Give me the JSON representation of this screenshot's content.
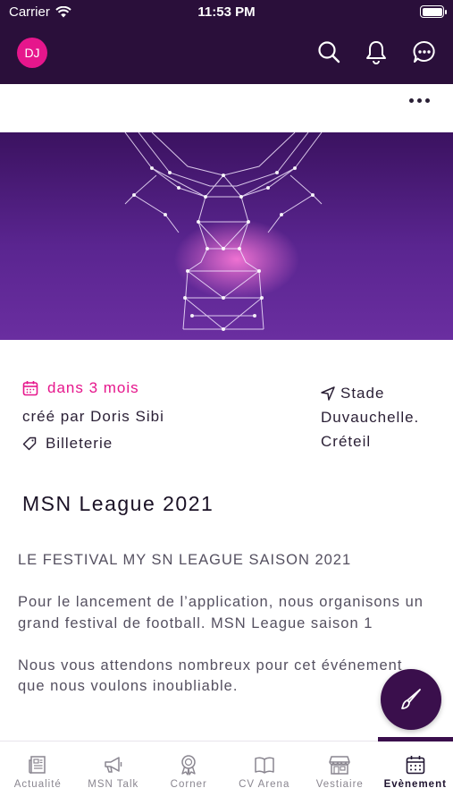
{
  "status_bar": {
    "carrier": "Carrier",
    "time": "11:53 PM"
  },
  "header": {
    "avatar_initials": "DJ"
  },
  "event": {
    "date_label": "dans 3 mois",
    "created_by_prefix": "créé par",
    "created_by_name": "Doris Sibi",
    "ticket_label": "Billeterie",
    "location_line1": "Stade",
    "location_line2": "Duvauchelle.",
    "location_line3": "Créteil",
    "title": "MSN League 2021",
    "description": [
      "LE FESTIVAL MY SN LEAGUE SAISON 2021",
      "Pour le lancement de l’application, nous organisons un grand festival de football. MSN League saison 1",
      "Nous vous attendons nombreux pour cet événement que nous voulons inoubliable."
    ]
  },
  "tabs": [
    {
      "label": "Actualité",
      "icon": "newspaper-icon"
    },
    {
      "label": "MSN Talk",
      "icon": "megaphone-icon"
    },
    {
      "label": "Corner",
      "icon": "award-icon"
    },
    {
      "label": "CV Arena",
      "icon": "book-icon"
    },
    {
      "label": "Vestiaire",
      "icon": "store-icon"
    },
    {
      "label": "Evènement",
      "icon": "calendar-icon"
    }
  ],
  "colors": {
    "header_bg": "#2a0f3a",
    "accent": "#e6168c",
    "fab_bg": "#3a0f4c"
  }
}
